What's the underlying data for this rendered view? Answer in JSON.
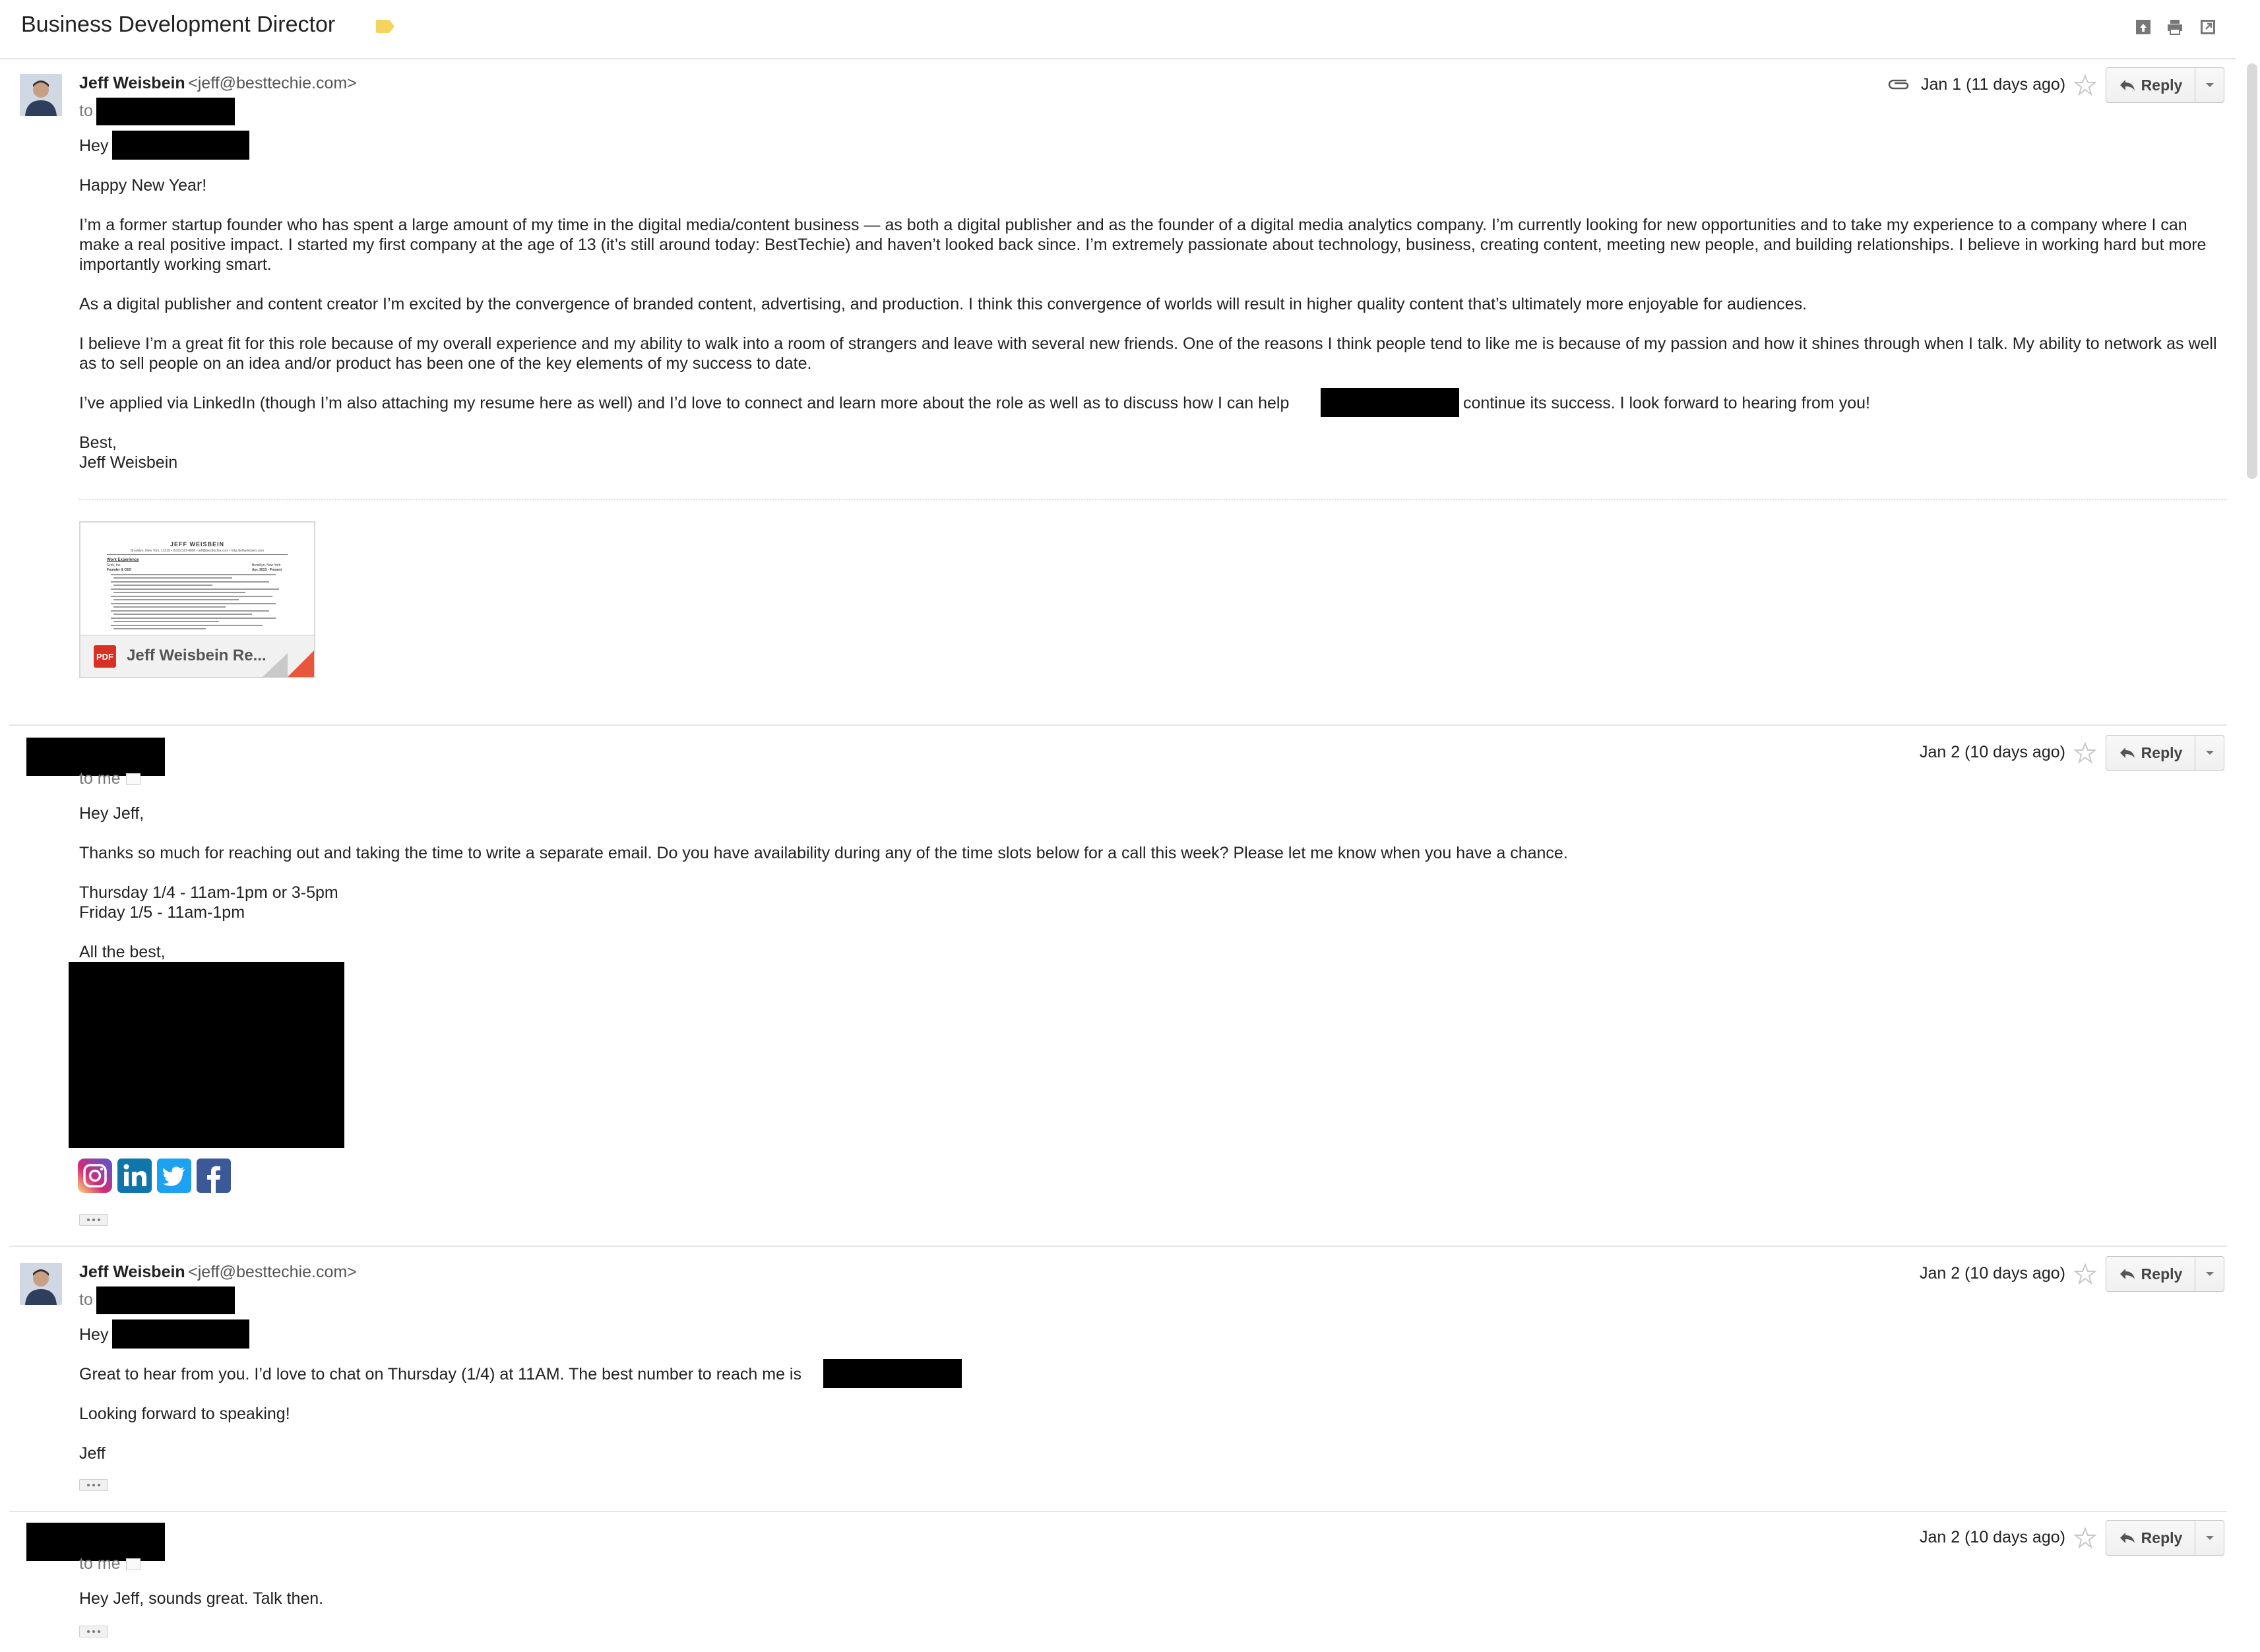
{
  "subject": {
    "title": "Business Development Director"
  },
  "messages": [
    {
      "sender_name": "Jeff Weisbein",
      "sender_email": "<jeff@besttechie.com>",
      "to_prefix": "to",
      "date": "Jan 1 (11 days ago)",
      "reply_label": "Reply",
      "greeting": "Hey",
      "paragraphs": [
        "Happy New Year!",
        "I’m a former startup founder who has spent a large amount of my time in the digital media/content business — as both a digital publisher and as the founder of a digital media analytics company. I’m currently looking for new opportunities and to take my experience to a company where I can make a real positive impact. I started my first company at the age of 13 (it’s still around today: BestTechie) and haven’t looked back since. I’m extremely passionate about technology, business, creating content, meeting new people, and building relationships. I believe in working hard but more importantly working smart.",
        "As a digital publisher and content creator I’m excited by the convergence of branded content, advertising, and production. I think this convergence of worlds will result in higher quality content that’s ultimately more enjoyable for audiences.",
        "I believe I’m a great fit for this role because of my overall experience and my ability to walk into a room of strangers and leave with several new friends. One of the reasons I think people tend to like me is because of my passion and how it shines through when I talk. My ability to network as well as to sell people on an idea and/or product has been one of the key elements of my success to date."
      ],
      "p5_before": "I’ve applied via LinkedIn (though I’m also attaching my resume here as well) and I’d love to connect and learn more about the role as well as to discuss how I can help",
      "p5_after": "continue its success. I look forward to hearing from you!",
      "signoff": "Best,",
      "signature": "Jeff Weisbein",
      "attachment": {
        "name": "Jeff Weisbein Re...",
        "type_badge": "PDF",
        "preview_header": "Jeff Weisbein",
        "preview_contact": "Brooklyn, New York, 11219 • (516) 523-4896 • jeff@besttechie.com • http://jeffweisbein.com",
        "preview_section": "Work Experience",
        "preview_role": "Founder & CEO",
        "preview_company": "Grok, Inc.",
        "preview_location": "Brooklyn, New York",
        "preview_dates": "Apr. 2013 - Present"
      }
    },
    {
      "to_label": "to me",
      "date": "Jan 2 (10 days ago)",
      "reply_label": "Reply",
      "greeting": "Hey Jeff,",
      "body": "Thanks so much for reaching out and taking the time to write a separate email. Do you have availability during any of the time slots below for a call this week? Please let me know when you have a chance.",
      "slot1": "Thursday 1/4 - 11am-1pm or 3-5pm",
      "slot2": "Friday 1/5 - 11am-1pm",
      "signoff": "All the best,",
      "social": [
        "instagram-icon",
        "linkedin-icon",
        "twitter-icon",
        "facebook-icon"
      ]
    },
    {
      "sender_name": "Jeff Weisbein",
      "sender_email": "<jeff@besttechie.com>",
      "to_prefix": "to",
      "date": "Jan 2 (10 days ago)",
      "reply_label": "Reply",
      "greeting": "Hey",
      "body_before": "Great to hear from you. I’d love to chat on Thursday (1/4) at 11AM. The best number to reach me is",
      "line2": "Looking forward to speaking!",
      "signature": "Jeff"
    },
    {
      "to_label": "to me",
      "date": "Jan 2 (10 days ago)",
      "reply_label": "Reply",
      "body": "Hey Jeff, sounds great. Talk then."
    }
  ],
  "colors": {
    "label_yellow": "#f4d35e",
    "pdf_red": "#d93025",
    "instagram": "#c13584",
    "linkedin": "#0077b5",
    "twitter": "#1da1f2",
    "facebook": "#3b5998"
  }
}
